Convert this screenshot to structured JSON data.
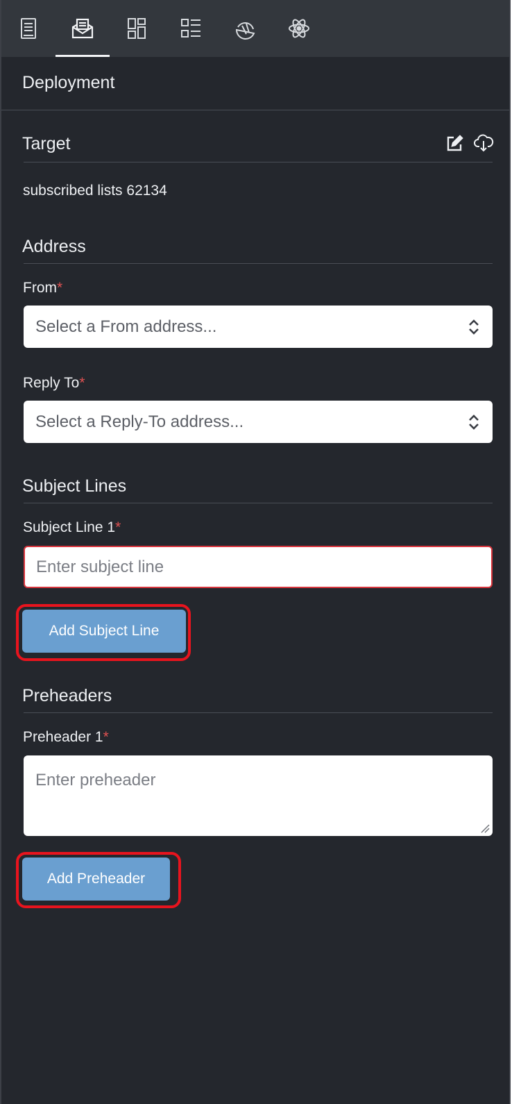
{
  "toolbar": {
    "tabs": [
      {
        "icon": "document-icon",
        "active": false
      },
      {
        "icon": "mail-icon",
        "active": true
      },
      {
        "icon": "layout-grid-icon",
        "active": false
      },
      {
        "icon": "list-icon",
        "active": false
      },
      {
        "icon": "pie-icon",
        "active": false
      },
      {
        "icon": "atom-icon",
        "active": false
      }
    ]
  },
  "header": {
    "title": "Deployment"
  },
  "target": {
    "title": "Target",
    "value": "subscribed lists 62134",
    "actions": [
      "edit-icon",
      "cloud-download-icon"
    ]
  },
  "address": {
    "title": "Address",
    "from_label": "From",
    "from_placeholder": "Select a From address...",
    "reply_label": "Reply To",
    "reply_placeholder": "Select a Reply-To address..."
  },
  "subject": {
    "title": "Subject Lines",
    "field_label": "Subject Line 1",
    "placeholder": "Enter subject line",
    "add_button": "Add Subject Line"
  },
  "preheaders": {
    "title": "Preheaders",
    "field_label": "Preheader 1",
    "placeholder": "Enter preheader",
    "add_button": "Add Preheader"
  },
  "required_marker": "*",
  "colors": {
    "panel_bg": "#24272d",
    "toolbar_bg": "#33373d",
    "button_bg": "#6a9fd0",
    "required": "#e05252",
    "highlight": "#e8141e"
  }
}
